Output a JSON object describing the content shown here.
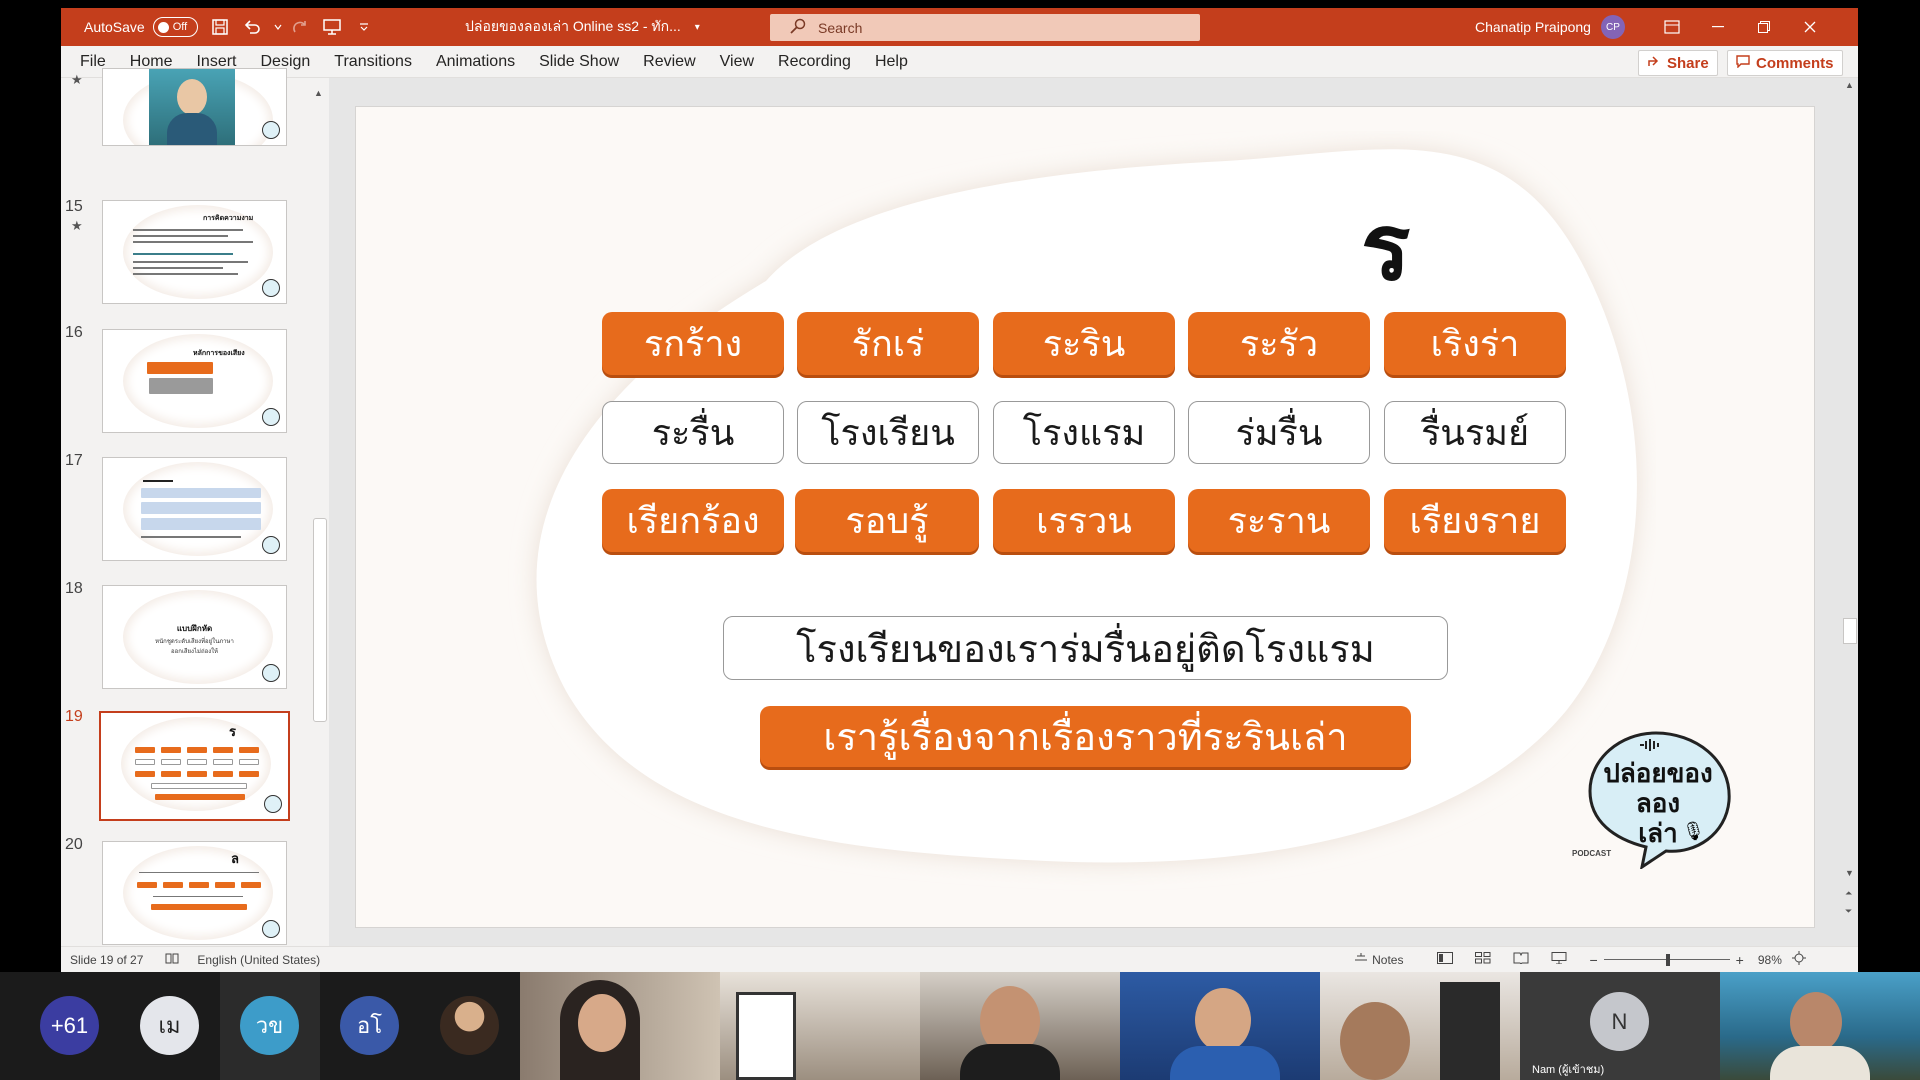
{
  "titlebar": {
    "autosave_label": "AutoSave",
    "autosave_state": "Off",
    "doc_title": "ปล่อยของลองเล่า Online ss2 - ทัก...",
    "search_placeholder": "Search",
    "user_name": "Chanatip Praipong",
    "user_initials": "CP"
  },
  "menu": [
    "File",
    "Home",
    "Insert",
    "Design",
    "Transitions",
    "Animations",
    "Slide Show",
    "Review",
    "View",
    "Recording",
    "Help"
  ],
  "ribbon_right": {
    "share": "Share",
    "comments": "Comments"
  },
  "thumbnails": [
    {
      "num": "15",
      "star": "★"
    },
    {
      "num": "16"
    },
    {
      "num": "17"
    },
    {
      "num": "18"
    },
    {
      "num": "19"
    },
    {
      "num": "20"
    }
  ],
  "thumb_text": {
    "t15_title": "การคิดความงาม",
    "t16_title": "หลักการของเสียง",
    "t18_title": "แบบฝึกหัด",
    "t18_body1": "หนักชูดระดับเสียงที่อยู่ในภาษา",
    "t18_body2": "ออกเสียงไม่ถ่องให้",
    "t19_letter": "ร",
    "t20_letter": "ล"
  },
  "slide": {
    "letter": "ร",
    "row1": [
      "รกร้าง",
      "รักเร่",
      "ระริน",
      "ระรัว",
      "เริงร่า"
    ],
    "row2": [
      "ระรื่น",
      "โรงเรียน",
      "โรงแรม",
      "ร่มรื่น",
      "รื่นรมย์"
    ],
    "row3": [
      "เรียกร้อง",
      "รอบรู้",
      "เรรวน",
      "ระราน",
      "เรียงราย"
    ],
    "sentence1": "โรงเรียนของเราร่มรื่นอยู่ติดโรงแรม",
    "sentence2": "เรารู้เรื่องจากเรื่องราวที่ระรินเล่า",
    "logo_line1": "ปล่อยของ",
    "logo_line2": "ลอง",
    "logo_line3": "เล่า",
    "logo_brand": "PODCAST"
  },
  "statusbar": {
    "slide_info": "Slide 19 of 27",
    "language": "English (United States)",
    "notes": "Notes",
    "zoom": "98%"
  },
  "participants": [
    {
      "label": "+61",
      "color": "#3b3da1"
    },
    {
      "label": "เม",
      "color": "#e4e6eb"
    },
    {
      "label": "วข",
      "color": "#3d9cc9"
    },
    {
      "label": "อโ",
      "color": "#3a59a8"
    },
    {
      "label": "N",
      "color": "#c5c7cc"
    }
  ],
  "participant_name": "Nam (ผู้เข้าชม)",
  "colors": {
    "accent": "#c43e1c",
    "word_orange": "#e76b1c"
  }
}
